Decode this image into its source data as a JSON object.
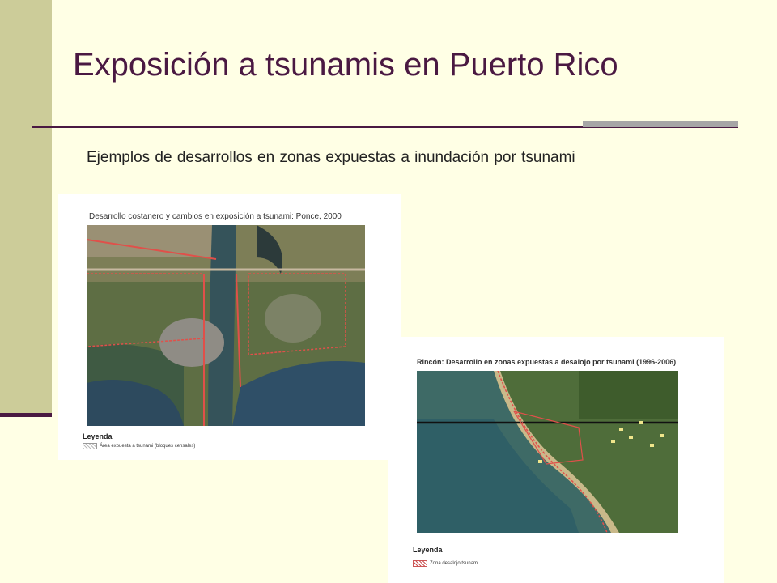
{
  "slide": {
    "title": "Exposición a tsunamis en Puerto Rico",
    "subtitle": "Ejemplos  de desarrollos en zonas expuestas a inundación por tsunami"
  },
  "map_ponce": {
    "title": "Desarrollo costanero y cambios en exposición a tsunami: Ponce, 2000",
    "legend_heading": "Leyenda",
    "legend_item": "Área expuesta a tsunami (bloques censales)"
  },
  "map_rincon": {
    "title": "Rincón: Desarrollo en zonas expuestas a desalojo por tsunami (1996-2006)",
    "legend_heading": "Leyenda",
    "legend_item": "Zona desalojo tsunami"
  },
  "colors": {
    "background": "#FFFFE5",
    "sidebar": "#CCCC99",
    "accent": "#4A1942",
    "rule_accent": "#A6A6A6",
    "exposure_outline": "#E0504A"
  }
}
